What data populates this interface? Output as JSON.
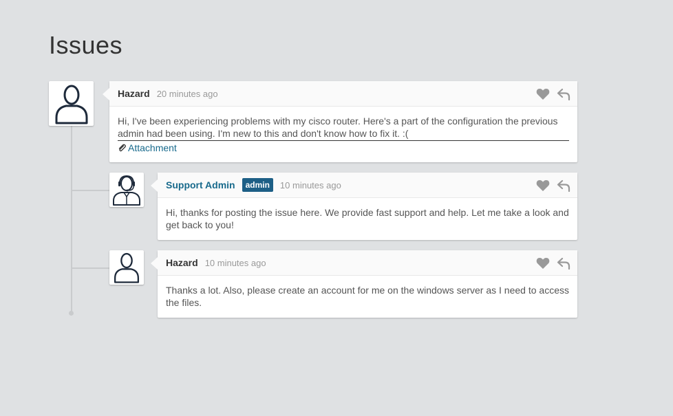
{
  "page": {
    "title": "Issues"
  },
  "comments": [
    {
      "author": "Hazard",
      "time": "20 minutes ago",
      "body": "Hi, I've been experiencing problems with my cisco router. Here's a part of the configuration the previous admin had been using. I'm new to this and don't know how to fix it. :(",
      "attachment_label": "Attachment",
      "avatar_icon": "user-icon"
    },
    {
      "author": "Support Admin",
      "badge": "admin",
      "time": "10 minutes ago",
      "body": "Hi, thanks for posting the issue here. We provide fast support and help. Let me take a look and get back to you!",
      "avatar_icon": "support-agent-icon"
    },
    {
      "author": "Hazard",
      "time": "10 minutes ago",
      "body": "Thanks a lot. Also, please create an account for me on the windows server as I need to access the files.",
      "avatar_icon": "user-icon"
    }
  ],
  "colors": {
    "background": "#dfe1e3",
    "link": "#186a8c",
    "badge": "#1d5f86",
    "icon": "#999999",
    "avatar_stroke": "#1e2a3b"
  }
}
